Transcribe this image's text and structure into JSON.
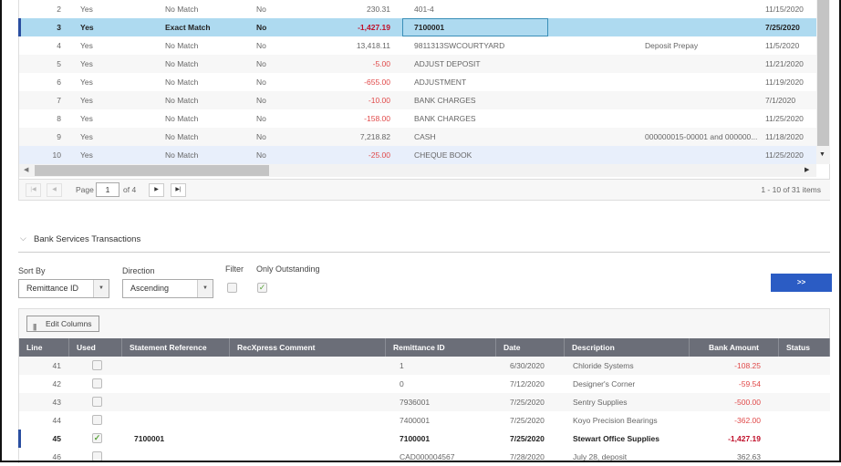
{
  "top_grid": {
    "rows": [
      {
        "line": "2",
        "col2": "Yes",
        "match": "No Match",
        "col4": "No",
        "amount": "230.31",
        "reference": "401-4",
        "comment": "",
        "date": "11/15/2020"
      },
      {
        "line": "3",
        "col2": "Yes",
        "match": "Exact Match",
        "col4": "No",
        "amount": "-1,427.19",
        "reference": "7100001",
        "comment": "",
        "date": "7/25/2020"
      },
      {
        "line": "4",
        "col2": "Yes",
        "match": "No Match",
        "col4": "No",
        "amount": "13,418.11",
        "reference": "9811313SWCOURTYARD",
        "comment": "Deposit Prepay",
        "date": "11/5/2020"
      },
      {
        "line": "5",
        "col2": "Yes",
        "match": "No Match",
        "col4": "No",
        "amount": "-5.00",
        "reference": "ADJUST DEPOSIT",
        "comment": "",
        "date": "11/21/2020"
      },
      {
        "line": "6",
        "col2": "Yes",
        "match": "No Match",
        "col4": "No",
        "amount": "-655.00",
        "reference": "ADJUSTMENT",
        "comment": "",
        "date": "11/19/2020"
      },
      {
        "line": "7",
        "col2": "Yes",
        "match": "No Match",
        "col4": "No",
        "amount": "-10.00",
        "reference": "BANK CHARGES",
        "comment": "",
        "date": "7/1/2020"
      },
      {
        "line": "8",
        "col2": "Yes",
        "match": "No Match",
        "col4": "No",
        "amount": "-158.00",
        "reference": "BANK CHARGES",
        "comment": "",
        "date": "11/25/2020"
      },
      {
        "line": "9",
        "col2": "Yes",
        "match": "No Match",
        "col4": "No",
        "amount": "7,218.82",
        "reference": "CASH",
        "comment": "000000015-00001 and 000000...",
        "date": "11/18/2020"
      },
      {
        "line": "10",
        "col2": "Yes",
        "match": "No Match",
        "col4": "No",
        "amount": "-25.00",
        "reference": "CHEQUE BOOK",
        "comment": "",
        "date": "11/25/2020"
      }
    ],
    "pager": {
      "page_label": "Page",
      "page": "1",
      "of_label": "of 4",
      "summary": "1 - 10 of 31 items"
    }
  },
  "section": {
    "title": "Bank Services Transactions"
  },
  "controls": {
    "sort_by_label": "Sort By",
    "sort_by_value": "Remittance ID",
    "direction_label": "Direction",
    "direction_value": "Ascending",
    "filter_label": "Filter",
    "filter_checked": false,
    "only_outstanding_label": "Only Outstanding",
    "only_outstanding_checked": true,
    "go_label": ">>"
  },
  "bottom_grid": {
    "edit_columns_label": "Edit Columns",
    "columns": [
      "Line",
      "Used",
      "Statement Reference",
      "RecXpress Comment",
      "Remittance ID",
      "Date",
      "Description",
      "Bank Amount",
      "Status"
    ],
    "rows": [
      {
        "line": "41",
        "used": false,
        "statement_ref": "",
        "comment": "",
        "remittance_id": "1",
        "date": "6/30/2020",
        "description": "Chloride Systems",
        "amount": "-108.25",
        "status": ""
      },
      {
        "line": "42",
        "used": false,
        "statement_ref": "",
        "comment": "",
        "remittance_id": "0",
        "date": "7/12/2020",
        "description": "Designer's Corner",
        "amount": "-59.54",
        "status": ""
      },
      {
        "line": "43",
        "used": false,
        "statement_ref": "",
        "comment": "",
        "remittance_id": "7936001",
        "date": "7/25/2020",
        "description": "Sentry Supplies",
        "amount": "-500.00",
        "status": ""
      },
      {
        "line": "44",
        "used": false,
        "statement_ref": "",
        "comment": "",
        "remittance_id": "7400001",
        "date": "7/25/2020",
        "description": "Koyo Precision Bearings",
        "amount": "-362.00",
        "status": ""
      },
      {
        "line": "45",
        "used": true,
        "statement_ref": "7100001",
        "comment": "",
        "remittance_id": "7100001",
        "date": "7/25/2020",
        "description": "Stewart Office Supplies",
        "amount": "-1,427.19",
        "status": ""
      },
      {
        "line": "46",
        "used": false,
        "statement_ref": "",
        "comment": "",
        "remittance_id": "CAD000004567",
        "date": "7/28/2020",
        "description": "July 28, deposit",
        "amount": "362.63",
        "status": ""
      }
    ]
  },
  "colors": {
    "selected_row": "#aedaf0",
    "header": "#6b6e78",
    "accent": "#2b5cc4",
    "negative": "#e04848"
  }
}
